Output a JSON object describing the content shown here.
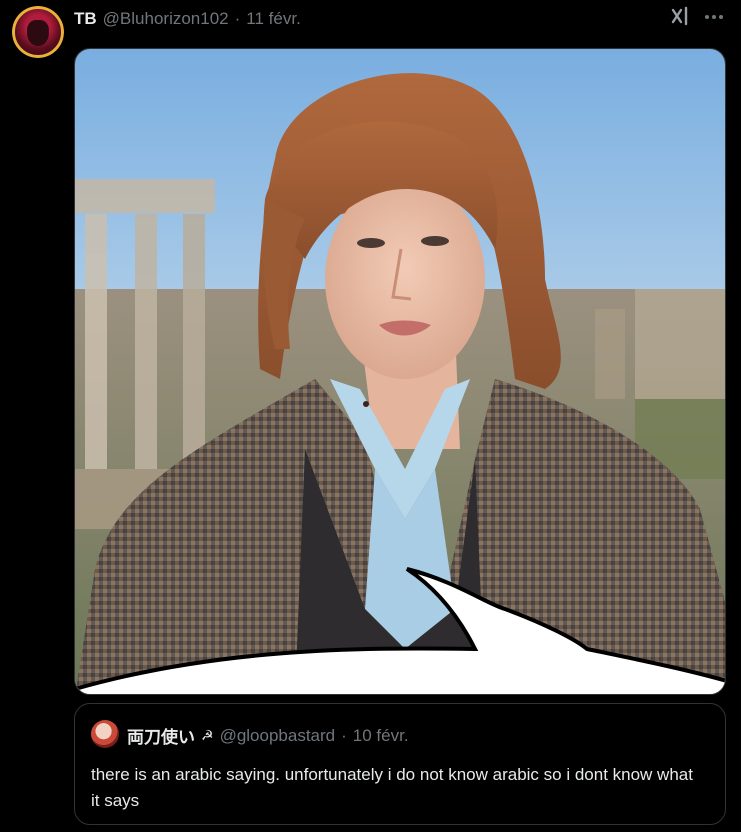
{
  "post": {
    "name": "TB",
    "handle": "@Bluhorizon102",
    "separator": "·",
    "date": "11 févr."
  },
  "icons": {
    "grok": "grok-icon",
    "more": "more-icon"
  },
  "quote": {
    "name": "両刀使い",
    "flag": "☭",
    "handle": "@gloopbastard",
    "separator": "·",
    "date": "10 févr.",
    "text": "there is an arabic saying. unfortunately i do not know arabic so i dont know what it says"
  },
  "colors": {
    "background": "#000000",
    "text": "#e7e9ea",
    "muted": "#71767b",
    "border": "#2f3336"
  }
}
